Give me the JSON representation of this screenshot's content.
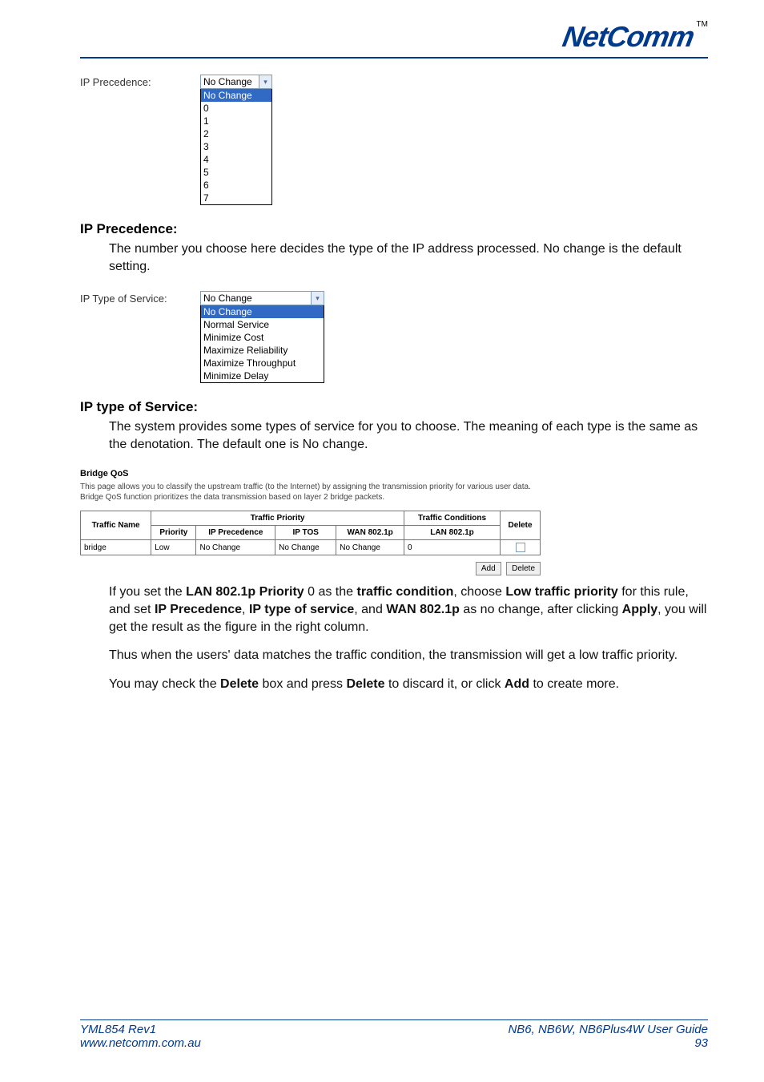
{
  "logo": {
    "text": "NetComm",
    "tm": "TM"
  },
  "precedence_field": {
    "label": "IP Precedence:",
    "selected": "No Change",
    "options": [
      "No Change",
      "0",
      "1",
      "2",
      "3",
      "4",
      "5",
      "6",
      "7"
    ],
    "selected_index": 0
  },
  "precedence_section": {
    "heading": "IP Precedence:",
    "body": "The number you choose here decides the type of the IP address processed. No change is the default setting."
  },
  "tos_field": {
    "label": "IP Type of Service:",
    "selected": "No Change",
    "options": [
      "No Change",
      "Normal Service",
      "Minimize Cost",
      "Maximize Reliability",
      "Maximize Throughput",
      "Minimize Delay"
    ],
    "selected_index": 0
  },
  "tos_section": {
    "heading": "IP type of Service:",
    "body": "The system provides some types of service for you to choose. The meaning of each type is the same as the denotation. The default one is No change."
  },
  "bridge_qos": {
    "title": "Bridge QoS",
    "description": "This page allows you to classify the upstream traffic (to the Internet) by assigning the transmission priority for various user data. Bridge QoS function prioritizes the data transmission based on layer 2 bridge packets.",
    "group_headers": {
      "priority": "Traffic Priority",
      "conditions": "Traffic Conditions"
    },
    "columns": [
      "Traffic Name",
      "Priority",
      "IP Precedence",
      "IP TOS",
      "WAN 802.1p",
      "LAN 802.1p",
      "Delete"
    ],
    "rows": [
      {
        "name": "bridge",
        "priority": "Low",
        "ip_prec": "No Change",
        "ip_tos": "No Change",
        "wan": "No Change",
        "lan": "0"
      }
    ],
    "buttons": {
      "add": "Add",
      "delete": "Delete"
    }
  },
  "paragraphs": {
    "p1_parts": [
      "If you set the ",
      "LAN 802.1p Priority",
      " 0 as the ",
      "traffic condition",
      ", choose ",
      "Low traffic priority",
      " for this rule, and set ",
      "IP Precedence",
      ", ",
      "IP type of service",
      ", and ",
      "WAN 802.1p",
      " as no change, after clicking ",
      "Apply",
      ", you will get the result as the figure in the right column."
    ],
    "p2": "Thus when the users' data matches the traffic condition, the transmission will get a low traffic priority.",
    "p3_parts": [
      "You may check the ",
      "Delete",
      " box and press ",
      "Delete",
      " to discard it, or click ",
      "Add",
      " to create more."
    ]
  },
  "footer": {
    "left_line1": "YML854 Rev1",
    "left_line2": "www.netcomm.com.au",
    "right_line1_a": "NB6, NB6W, NB6Plus4W ",
    "right_line1_b": "User Guide",
    "right_line2": "93"
  }
}
